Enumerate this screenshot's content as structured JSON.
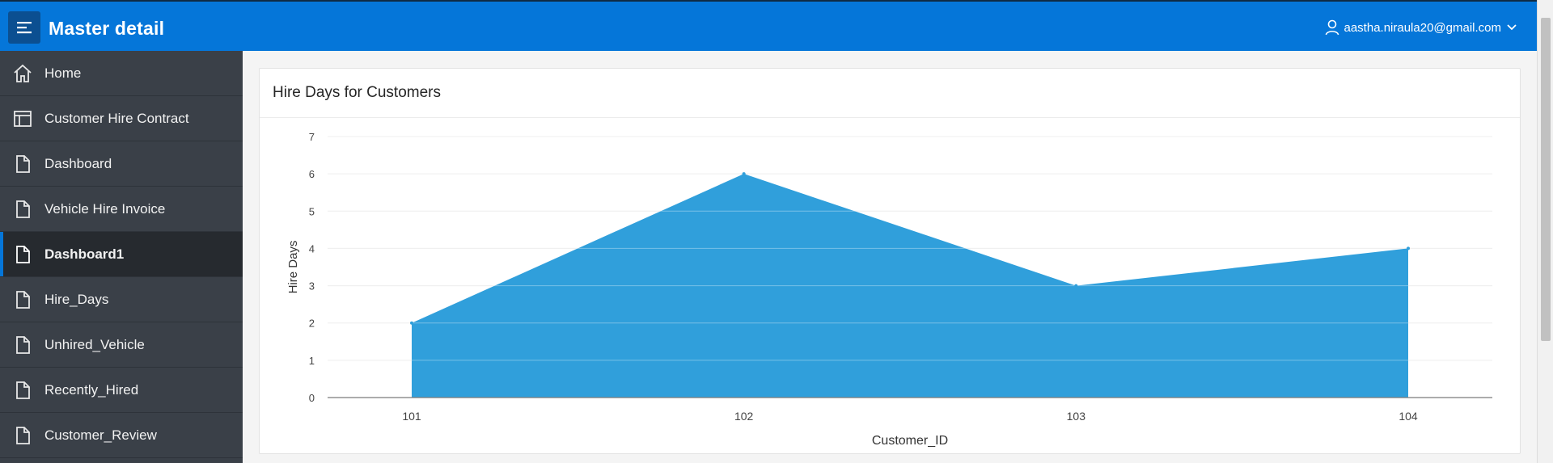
{
  "app": {
    "title": "Master detail"
  },
  "user": {
    "email": "aastha.niraula20@gmail.com"
  },
  "sidebar": {
    "items": [
      {
        "label": "Home",
        "icon": "home-icon"
      },
      {
        "label": "Customer Hire Contract",
        "icon": "table-icon"
      },
      {
        "label": "Dashboard",
        "icon": "page-icon"
      },
      {
        "label": "Vehicle Hire Invoice",
        "icon": "page-icon"
      },
      {
        "label": "Dashboard1",
        "icon": "page-icon",
        "active": true
      },
      {
        "label": "Hire_Days",
        "icon": "page-icon"
      },
      {
        "label": "Unhired_Vehicle",
        "icon": "page-icon"
      },
      {
        "label": "Recently_Hired",
        "icon": "page-icon"
      },
      {
        "label": "Customer_Review",
        "icon": "page-icon"
      }
    ]
  },
  "region": {
    "title": "Hire Days for Customers"
  },
  "colors": {
    "header": "#0576d9",
    "sidebar": "#3a4048",
    "area": "#309fdb"
  },
  "chart_data": {
    "type": "area",
    "title": "Hire Days for Customers",
    "xlabel": "Customer_ID",
    "ylabel": "Hire Days",
    "categories": [
      "101",
      "102",
      "103",
      "104"
    ],
    "values": [
      2,
      6,
      3,
      4
    ],
    "ylim": [
      0,
      7
    ],
    "yticks": [
      "0",
      "1",
      "2",
      "3",
      "4",
      "5",
      "6",
      "7"
    ],
    "grid": true,
    "legend": "none"
  }
}
